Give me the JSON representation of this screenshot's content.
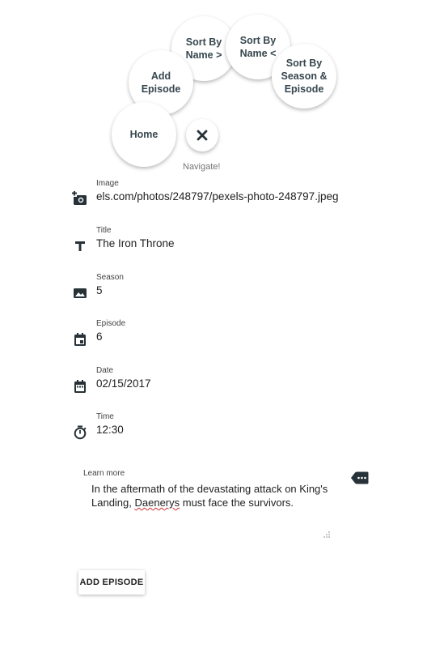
{
  "nav": {
    "sort_name_asc": "Sort By Name >",
    "sort_name_desc": "Sort By Name <",
    "add_episode": "Add Episode",
    "sort_season": "Sort By Season & Episode",
    "home": "Home",
    "label": "Navigate!",
    "close_icon": "close-icon"
  },
  "form": {
    "image": {
      "label": "Image",
      "value": "els.com/photos/248797/pexels-photo-248797.jpeg",
      "icon": "add-photo-icon"
    },
    "title": {
      "label": "Title",
      "value": "The Iron Throne",
      "icon": "title-icon"
    },
    "season": {
      "label": "Season",
      "value": "5",
      "icon": "image-icon"
    },
    "episode": {
      "label": "Episode",
      "value": "6",
      "icon": "event-icon"
    },
    "date": {
      "label": "Date",
      "value": "02/15/2017",
      "icon": "calendar-icon"
    },
    "time": {
      "label": "Time",
      "value": "12:30",
      "icon": "timer-icon"
    },
    "description": {
      "label": "Learn more",
      "text_before": "In the aftermath of the devastating attack on King's Landing, ",
      "misspelled": "Daenerys",
      "text_after": " must face the survivors.",
      "icon": "comment-icon"
    }
  },
  "submit_label": "ADD EPISODE",
  "colors": {
    "accent": "#37474f",
    "icon": "#263238",
    "spellcheck": "#d32f2f"
  }
}
